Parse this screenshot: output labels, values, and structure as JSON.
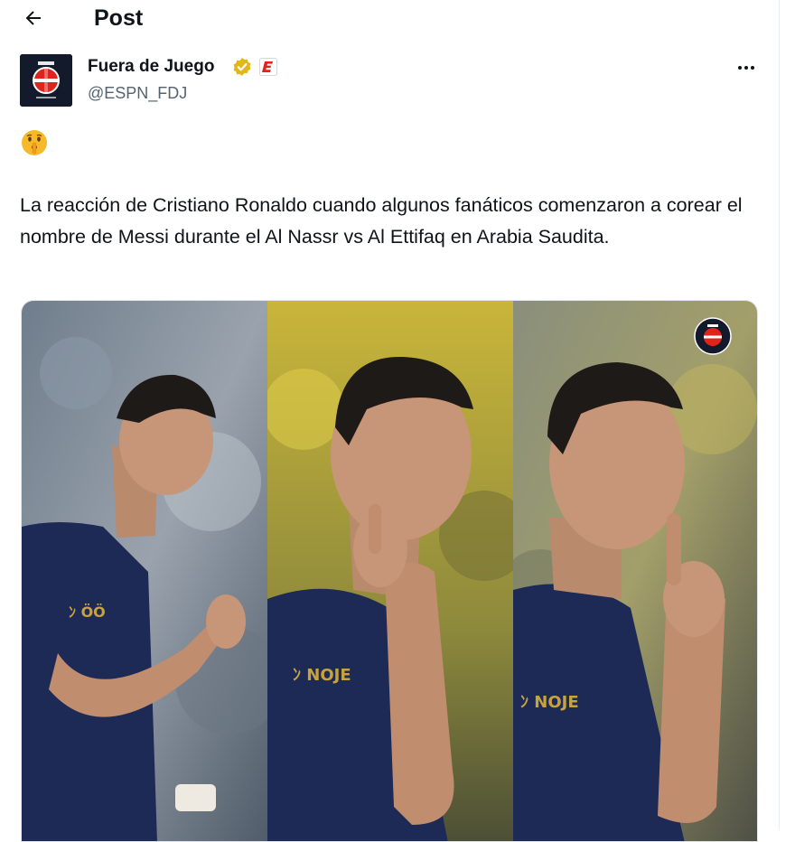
{
  "header": {
    "title": "Post"
  },
  "author": {
    "name": "Fuera de Juego",
    "handle": "@ESPN_FDJ",
    "avatar_icon": "espn-fdj-logo-icon",
    "verified_icon": "verified-badge-icon",
    "verified_color": "#e2b719",
    "affiliate_badge_icon": "espn-e-badge-icon",
    "affiliate_color": "#e0241c"
  },
  "post": {
    "emoji": "shushing-face-emoji",
    "text": "La reacción de Cristiano Ronaldo cuando algunos fanáticos comenzaron a corear el nombre de Messi durante el Al Nassr vs Al Ettifaq en Arabia Saudita."
  },
  "media": {
    "panels": [
      "ronaldo-gesture-calm",
      "ronaldo-gesture-hand-to-ear",
      "ronaldo-gesture-shush"
    ],
    "watermark_icon": "espn-fdj-logo-icon",
    "jersey_color": "#1c2a55",
    "jersey_text_color": "#c9a23e"
  },
  "colors": {
    "text_primary": "#0f1419",
    "text_secondary": "#536471",
    "divider": "#e6ecf0"
  }
}
